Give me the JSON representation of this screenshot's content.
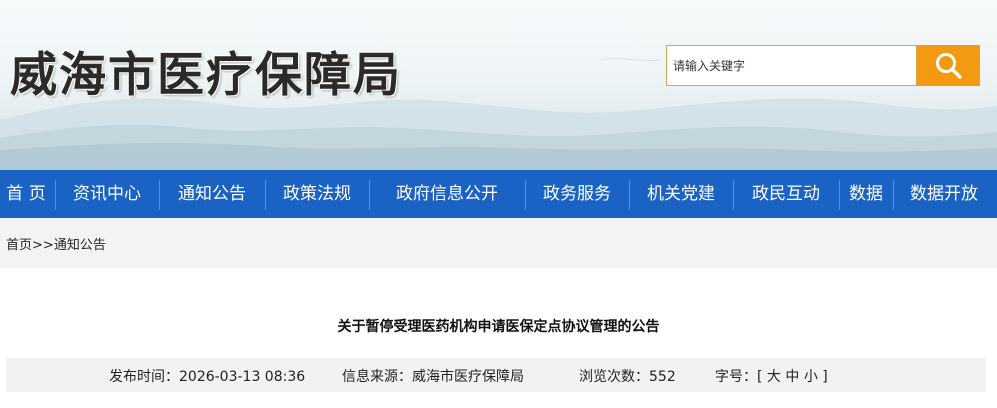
{
  "header": {
    "site_title": "威海市医疗保障局",
    "search": {
      "placeholder": "请输入关键字"
    }
  },
  "nav": {
    "items": [
      {
        "label": "首 页"
      },
      {
        "label": "资讯中心"
      },
      {
        "label": "通知公告"
      },
      {
        "label": "政策法规"
      },
      {
        "label": "政府信息公开"
      },
      {
        "label": "政务服务"
      },
      {
        "label": "机关党建"
      },
      {
        "label": "政民互动"
      },
      {
        "label": "数据"
      },
      {
        "label": "数据开放"
      }
    ]
  },
  "breadcrumb": {
    "home": "首页",
    "separator": ">>",
    "current": "通知公告"
  },
  "article": {
    "title": "关于暂停受理医药机构申请医保定点协议管理的公告",
    "meta": {
      "publish_label": "发布时间：",
      "publish_time": "2026-03-13 08:36",
      "source_label": "信息来源：",
      "source": "威海市医疗保障局",
      "views_label": "浏览次数：",
      "views": "552",
      "font_label": "字号：",
      "font_open": "[",
      "font_large": "大",
      "font_medium": "中",
      "font_small": "小",
      "font_close": "]"
    }
  },
  "colors": {
    "nav_bg": "#1a63c4",
    "search_button": "#f39a12",
    "crumb_bg": "#f3f3f3"
  },
  "icons": {
    "search_button_icon": "search-icon"
  }
}
